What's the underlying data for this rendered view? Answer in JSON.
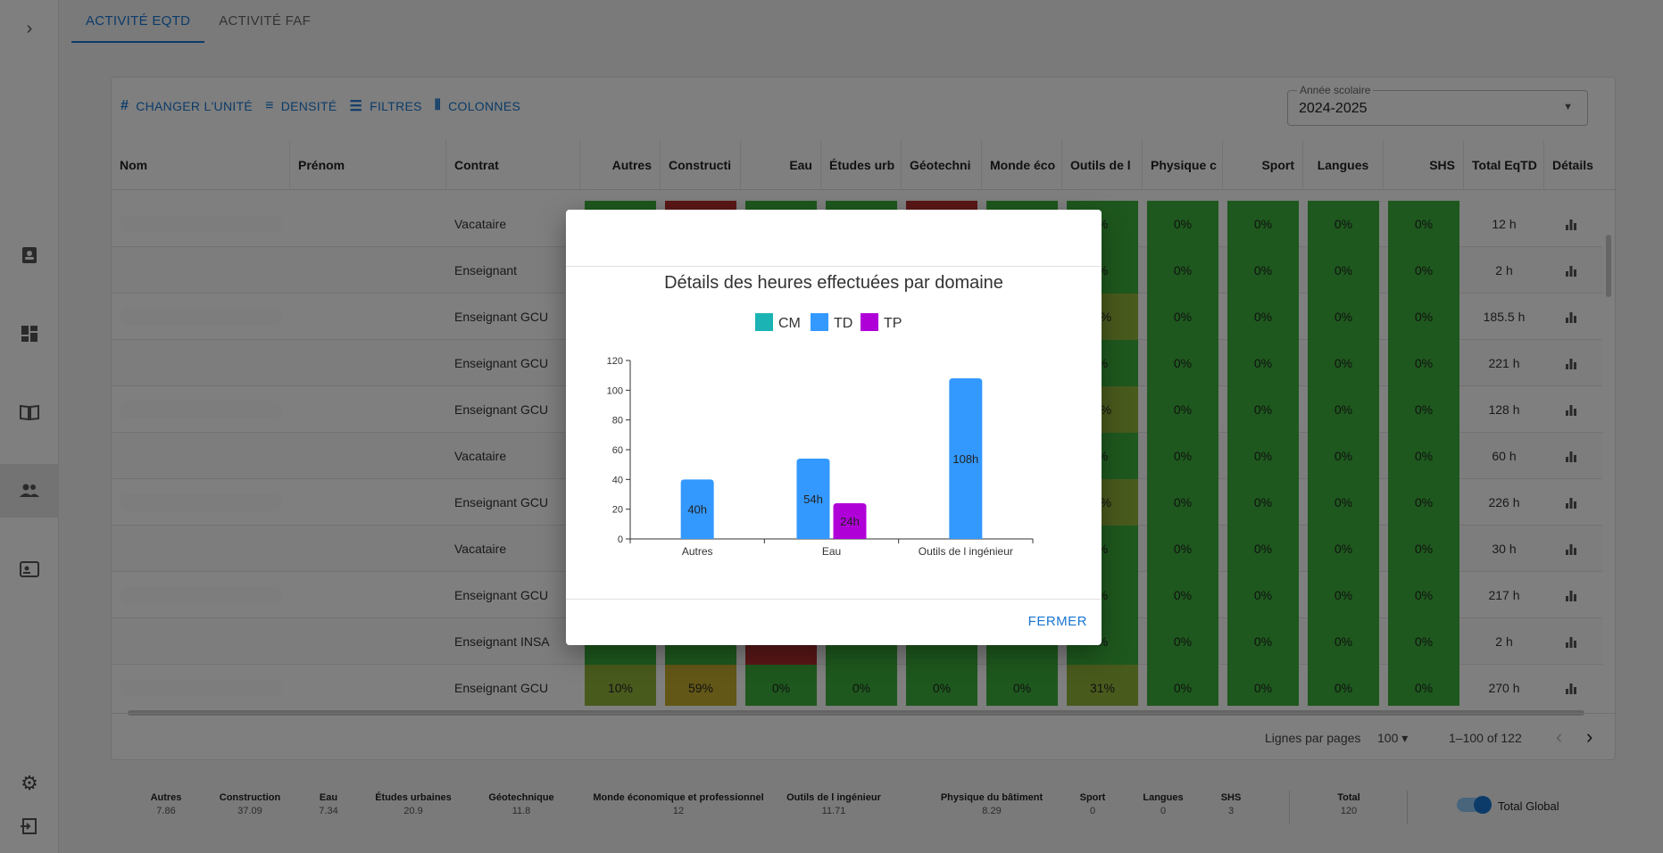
{
  "tabs": [
    {
      "label": "ACTIVITÉ EQTD",
      "active": true
    },
    {
      "label": "ACTIVITÉ FAF",
      "active": false
    }
  ],
  "toolbar": {
    "unit_label": "CHANGER L'UNITÉ",
    "density_label": "DENSITÉ",
    "filters_label": "FILTRES",
    "columns_label": "COLONNES"
  },
  "year_select": {
    "label": "Année scolaire",
    "value": "2024-2025"
  },
  "columns": {
    "nom": "Nom",
    "prenom": "Prénom",
    "contrat": "Contrat",
    "autres": "Autres",
    "construction": "Constructi",
    "eau": "Eau",
    "etudes": "Études urb",
    "geotech": "Géotechni",
    "monde": "Monde éco",
    "outils": "Outils de l",
    "physique": "Physique c",
    "sport": "Sport",
    "langues": "Langues",
    "shs": "SHS",
    "total": "Total EqTD",
    "details": "Détails"
  },
  "rows": [
    {
      "contrat": "Vacataire",
      "outils": "%",
      "physique": "0%",
      "sport": "0%",
      "langues": "0%",
      "shs": "0%",
      "total": "12 h"
    },
    {
      "contrat": "Enseignant",
      "outils": "%",
      "physique": "0%",
      "sport": "0%",
      "langues": "0%",
      "shs": "0%",
      "total": "2 h"
    },
    {
      "contrat": "Enseignant GCU",
      "outils": "4%",
      "physique": "0%",
      "sport": "0%",
      "langues": "0%",
      "shs": "0%",
      "total": "185.5 h"
    },
    {
      "contrat": "Enseignant GCU",
      "outils": "%",
      "physique": "0%",
      "sport": "0%",
      "langues": "0%",
      "shs": "0%",
      "total": "221 h"
    },
    {
      "contrat": "Enseignant GCU",
      "outils": "6%",
      "physique": "0%",
      "sport": "0%",
      "langues": "0%",
      "shs": "0%",
      "total": "128 h"
    },
    {
      "contrat": "Vacataire",
      "outils": "%",
      "physique": "0%",
      "sport": "0%",
      "langues": "0%",
      "shs": "0%",
      "total": "60 h"
    },
    {
      "contrat": "Enseignant GCU",
      "outils": "3%",
      "physique": "0%",
      "sport": "0%",
      "langues": "0%",
      "shs": "0%",
      "total": "226 h"
    },
    {
      "contrat": "Vacataire",
      "outils": "%",
      "physique": "0%",
      "sport": "0%",
      "langues": "0%",
      "shs": "0%",
      "total": "30 h"
    },
    {
      "contrat": "Enseignant GCU",
      "outils": "%",
      "physique": "0%",
      "sport": "0%",
      "langues": "0%",
      "shs": "0%",
      "total": "217 h"
    },
    {
      "contrat": "Enseignant INSA",
      "outils": "%",
      "physique": "0%",
      "sport": "0%",
      "langues": "0%",
      "shs": "0%",
      "total": "2 h"
    },
    {
      "contrat": "Enseignant GCU",
      "autres": "10%",
      "construction": "59%",
      "eau": "0%",
      "etudes": "0%",
      "geotech": "0%",
      "monde": "0%",
      "outils": "31%",
      "physique": "0%",
      "sport": "0%",
      "langues": "0%",
      "shs": "0%",
      "total": "270 h"
    }
  ],
  "pagination": {
    "rows_per_page_label": "Lignes par pages",
    "rows_per_page_value": "100",
    "range": "1–100 of 122"
  },
  "summary": [
    {
      "name": "Autres",
      "value": "7.86"
    },
    {
      "name": "Construction",
      "value": "37.09"
    },
    {
      "name": "Eau",
      "value": "7.34"
    },
    {
      "name": "Études urbaines",
      "value": "20.9"
    },
    {
      "name": "Géotechnique",
      "value": "11.8"
    },
    {
      "name": "Monde économique et professionnel",
      "value": "12"
    },
    {
      "name": "Outils de l ingénieur",
      "value": "11.71"
    },
    {
      "name": "Physique du bâtiment",
      "value": "8.29"
    },
    {
      "name": "Sport",
      "value": "0"
    },
    {
      "name": "Langues",
      "value": "0"
    },
    {
      "name": "SHS",
      "value": "3"
    },
    {
      "name": "Total",
      "value": "120"
    }
  ],
  "toggle": {
    "label": "Total Global",
    "checked": true
  },
  "dialog": {
    "close_label": "FERMER"
  },
  "colors": {
    "green": "#3db13d",
    "red": "#b52e2e",
    "olive": "#93b53a",
    "yellow": "#c7ae2e",
    "cm": "#1bb3b3",
    "td": "#3399ff",
    "tp": "#b000d8",
    "accent": "#1976d2"
  },
  "chart_data": {
    "type": "bar",
    "title": "Détails des heures effectuées par domaine",
    "categories": [
      "Autres",
      "Eau",
      "Outils de l ingénieur"
    ],
    "series": [
      {
        "name": "CM",
        "color": "#1bb3b3",
        "values": [
          0,
          0,
          0
        ]
      },
      {
        "name": "TD",
        "color": "#3399ff",
        "values": [
          40,
          54,
          108
        ],
        "labels": [
          "40h",
          "54h",
          "108h"
        ]
      },
      {
        "name": "TP",
        "color": "#b000d8",
        "values": [
          0,
          24,
          0
        ],
        "labels": [
          "",
          "24h",
          ""
        ]
      }
    ],
    "ylim": [
      0,
      120
    ],
    "yticks": [
      0,
      20,
      40,
      60,
      80,
      100,
      120
    ],
    "legend": "top-center",
    "grid": false
  }
}
